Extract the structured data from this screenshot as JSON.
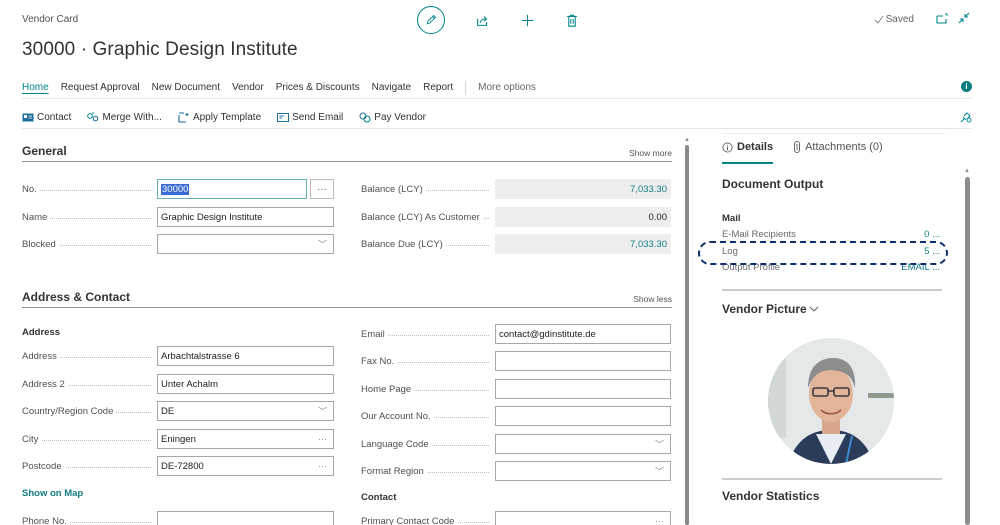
{
  "header": {
    "caption": "Vendor Card",
    "title": "30000 · Graphic Design Institute",
    "saved_label": "Saved"
  },
  "menu": {
    "items": [
      {
        "label": "Home",
        "active": true
      },
      {
        "label": "Request Approval"
      },
      {
        "label": "New Document"
      },
      {
        "label": "Vendor"
      },
      {
        "label": "Prices & Discounts"
      },
      {
        "label": "Navigate"
      },
      {
        "label": "Report"
      }
    ],
    "more_label": "More options"
  },
  "actions": [
    {
      "label": "Contact",
      "icon": "contact-card-icon"
    },
    {
      "label": "Merge With...",
      "icon": "merge-icon"
    },
    {
      "label": "Apply Template",
      "icon": "template-icon"
    },
    {
      "label": "Send Email",
      "icon": "email-icon"
    },
    {
      "label": "Pay Vendor",
      "icon": "pay-icon"
    }
  ],
  "general": {
    "title": "General",
    "toggle": "Show more",
    "no_label": "No.",
    "no_value": "30000",
    "name_label": "Name",
    "name_value": "Graphic Design Institute",
    "blocked_label": "Blocked",
    "blocked_value": "",
    "balance_label": "Balance (LCY)",
    "balance_value": "7,033.30",
    "balance_cust_label": "Balance (LCY) As Customer",
    "balance_cust_value": "0.00",
    "balance_due_label": "Balance Due (LCY)",
    "balance_due_value": "7,033.30"
  },
  "address_contact": {
    "title": "Address & Contact",
    "toggle": "Show less",
    "address_group": "Address",
    "address_label": "Address",
    "address_value": "Arbachtalstrasse 6",
    "address2_label": "Address 2",
    "address2_value": "Unter Achalm",
    "country_label": "Country/Region Code",
    "country_value": "DE",
    "city_label": "City",
    "city_value": "Eningen",
    "postcode_label": "Postcode",
    "postcode_value": "DE-72800",
    "show_on_map": "Show on Map",
    "phone_label": "Phone No.",
    "phone_value": "",
    "email_label": "Email",
    "email_value": "contact@gdinstitute.de",
    "fax_label": "Fax No.",
    "fax_value": "",
    "homepage_label": "Home Page",
    "homepage_value": "",
    "account_label": "Our Account No.",
    "account_value": "",
    "language_label": "Language Code",
    "language_value": "",
    "format_label": "Format Region",
    "format_value": "",
    "contact_group": "Contact",
    "primary_contact_label": "Primary Contact Code",
    "primary_contact_value": ""
  },
  "factbox": {
    "tabs": [
      {
        "label": "Details",
        "active": true
      },
      {
        "label": "Attachments (0)"
      }
    ],
    "doc_output_title": "Document Output",
    "mail_label": "Mail",
    "rows": [
      {
        "label": "E-Mail Recipients",
        "value": "0",
        "more": "..."
      },
      {
        "label": "Log",
        "value": "5",
        "more": "..."
      },
      {
        "label": "Output Profile",
        "value": "EMAIL",
        "more": "..."
      }
    ],
    "vendor_picture_title": "Vendor Picture",
    "vendor_statistics_title": "Vendor Statistics"
  },
  "colors": {
    "accent": "#00868a",
    "link": "#117d84",
    "focus_ring": "#0d2f6e",
    "selection": "#3a6ad4"
  }
}
